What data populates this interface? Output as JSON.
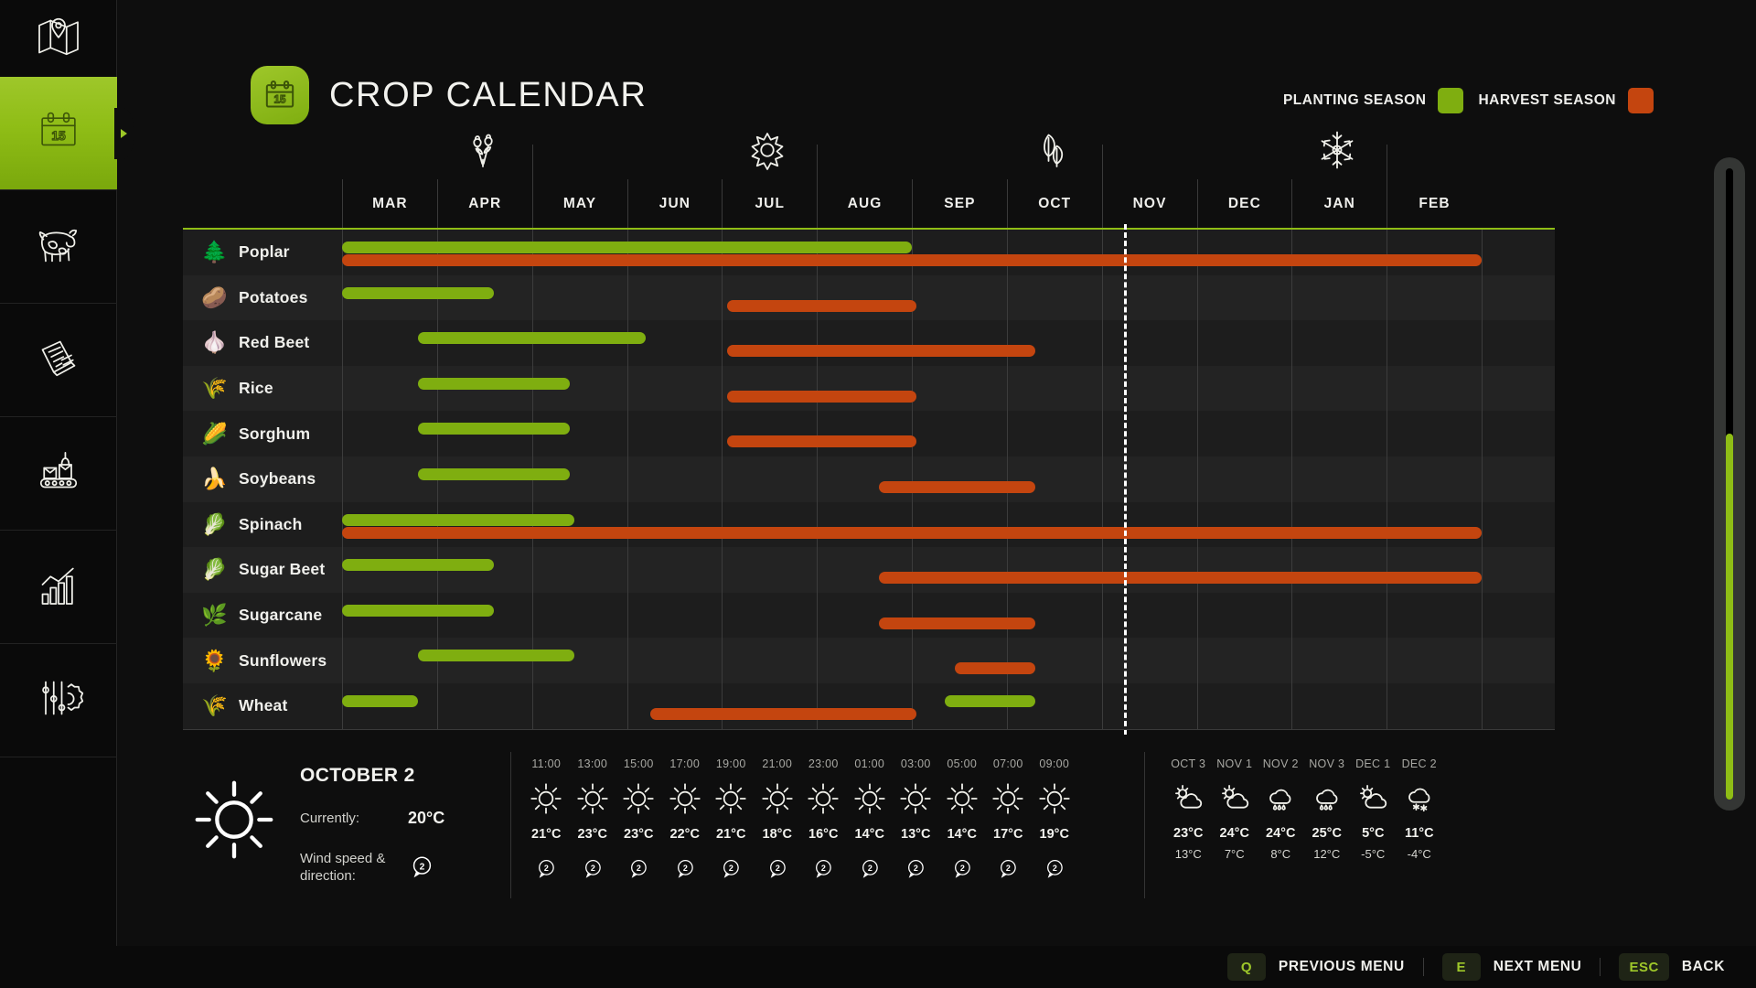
{
  "header": {
    "title": "CROP CALENDAR",
    "badge_icon": "calendar-15-icon",
    "legend": [
      {
        "label": "PLANTING SEASON",
        "color": "#7fae10"
      },
      {
        "label": "HARVEST SEASON",
        "color": "#c4450f"
      }
    ]
  },
  "sidebar": {
    "items": [
      {
        "name": "map",
        "icon": "map-pin-icon",
        "active": false
      },
      {
        "name": "calendar",
        "icon": "calendar-15-icon",
        "active": true
      },
      {
        "name": "livestock",
        "icon": "cow-icon",
        "active": false
      },
      {
        "name": "documents",
        "icon": "documents-icon",
        "active": false
      },
      {
        "name": "production",
        "icon": "conveyor-icon",
        "active": false
      },
      {
        "name": "statistics",
        "icon": "bar-chart-icon",
        "active": false
      },
      {
        "name": "settings",
        "icon": "sliders-gear-icon",
        "active": false
      }
    ]
  },
  "calendar": {
    "months": [
      "MAR",
      "APR",
      "MAY",
      "JUN",
      "JUL",
      "AUG",
      "SEP",
      "OCT",
      "NOV",
      "DEC",
      "JAN",
      "FEB"
    ],
    "seasons": [
      {
        "icon": "flowers-icon",
        "after_month_index": 1
      },
      {
        "icon": "sun-icon",
        "after_month_index": 4
      },
      {
        "icon": "leaves-icon",
        "after_month_index": 7
      },
      {
        "icon": "snowflake-icon",
        "after_month_index": 10
      }
    ],
    "today_marker_month": "OCT",
    "rows": [
      {
        "crop": "Poplar",
        "emoji": "🌲",
        "planting": [
          0.0,
          6.0
        ],
        "harvest": [
          0.0,
          12.0
        ]
      },
      {
        "crop": "Potatoes",
        "emoji": "🥔",
        "planting": [
          0.0,
          1.6
        ],
        "harvest": [
          4.05,
          6.05
        ]
      },
      {
        "crop": "Red Beet",
        "emoji": "🧄",
        "planting": [
          0.8,
          3.2
        ],
        "harvest": [
          4.05,
          7.3
        ]
      },
      {
        "crop": "Rice",
        "emoji": "🌾",
        "planting": [
          0.8,
          2.4
        ],
        "harvest": [
          4.05,
          6.05
        ]
      },
      {
        "crop": "Sorghum",
        "emoji": "🌽",
        "planting": [
          0.8,
          2.4
        ],
        "harvest": [
          4.05,
          6.05
        ]
      },
      {
        "crop": "Soybeans",
        "emoji": "🍌",
        "planting": [
          0.8,
          2.4
        ],
        "harvest": [
          5.65,
          7.3
        ]
      },
      {
        "crop": "Spinach",
        "emoji": "🥬",
        "planting": [
          0.0,
          2.45
        ],
        "harvest": [
          0.0,
          12.0
        ]
      },
      {
        "crop": "Sugar Beet",
        "emoji": "🥬",
        "planting": [
          0.0,
          1.6
        ],
        "harvest": [
          5.65,
          12.0
        ]
      },
      {
        "crop": "Sugarcane",
        "emoji": "🌿",
        "planting": [
          0.0,
          1.6
        ],
        "harvest": [
          5.65,
          7.3
        ]
      },
      {
        "crop": "Sunflowers",
        "emoji": "🌻",
        "planting": [
          0.8,
          2.45
        ],
        "harvest": [
          6.45,
          7.3
        ]
      },
      {
        "crop": "Wheat",
        "emoji": "🌾",
        "planting": [
          0.0,
          0.8
        ],
        "harvest": [
          3.25,
          6.05
        ],
        "planting2": [
          6.35,
          7.3
        ]
      }
    ]
  },
  "weather": {
    "current": {
      "icon": "sun-icon",
      "date": "OCTOBER 2",
      "currently_label": "Currently:",
      "currently_value": "20°C",
      "wind_label": "Wind speed & direction:",
      "wind_value": "2"
    },
    "hourly": [
      {
        "time": "11:00",
        "icon": "sun-icon",
        "temp": "21°C",
        "wind": "2"
      },
      {
        "time": "13:00",
        "icon": "sun-icon",
        "temp": "23°C",
        "wind": "2"
      },
      {
        "time": "15:00",
        "icon": "sun-icon",
        "temp": "23°C",
        "wind": "2"
      },
      {
        "time": "17:00",
        "icon": "sun-icon",
        "temp": "22°C",
        "wind": "2"
      },
      {
        "time": "19:00",
        "icon": "sun-icon",
        "temp": "21°C",
        "wind": "2"
      },
      {
        "time": "21:00",
        "icon": "sun-icon",
        "temp": "18°C",
        "wind": "2"
      },
      {
        "time": "23:00",
        "icon": "sun-icon",
        "temp": "16°C",
        "wind": "2"
      },
      {
        "time": "01:00",
        "icon": "sun-icon",
        "temp": "14°C",
        "wind": "2"
      },
      {
        "time": "03:00",
        "icon": "sun-icon",
        "temp": "13°C",
        "wind": "2"
      },
      {
        "time": "05:00",
        "icon": "sun-icon",
        "temp": "14°C",
        "wind": "2"
      },
      {
        "time": "07:00",
        "icon": "sun-icon",
        "temp": "17°C",
        "wind": "2"
      },
      {
        "time": "09:00",
        "icon": "sun-icon",
        "temp": "19°C",
        "wind": "2"
      }
    ],
    "daily": [
      {
        "day": "OCT 3",
        "icon": "sun-cloud-icon",
        "high": "23°C",
        "low": "13°C"
      },
      {
        "day": "NOV 1",
        "icon": "sun-cloud-icon",
        "high": "24°C",
        "low": "7°C"
      },
      {
        "day": "NOV 2",
        "icon": "rain-cloud-icon",
        "high": "24°C",
        "low": "8°C"
      },
      {
        "day": "NOV 3",
        "icon": "rain-cloud-icon",
        "high": "25°C",
        "low": "12°C"
      },
      {
        "day": "DEC 1",
        "icon": "sun-cloud-icon",
        "high": "5°C",
        "low": "-5°C"
      },
      {
        "day": "DEC 2",
        "icon": "snow-cloud-icon",
        "high": "11°C",
        "low": "-4°C"
      }
    ]
  },
  "bottom_bar": [
    {
      "key": "Q",
      "label": "PREVIOUS MENU"
    },
    {
      "key": "E",
      "label": "NEXT MENU"
    },
    {
      "key": "ESC",
      "label": "BACK"
    }
  ]
}
